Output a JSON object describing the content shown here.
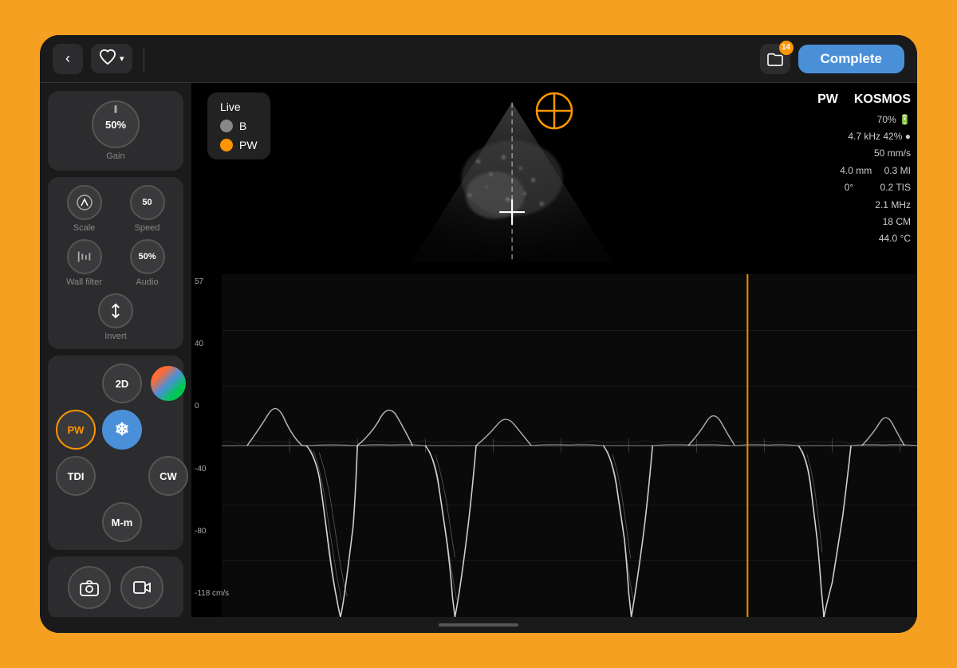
{
  "header": {
    "back_label": "‹",
    "heart_icon": "♥",
    "chevron": "▾",
    "folder_icon": "🗂",
    "badge_count": "14",
    "complete_label": "Complete"
  },
  "gain": {
    "value": "50%",
    "label": "Gain"
  },
  "controls": {
    "scale_label": "Scale",
    "speed_label": "Speed",
    "speed_value": "50",
    "wall_filter_label": "Wall filter",
    "audio_label": "Audio",
    "audio_value": "50%",
    "invert_label": "Invert"
  },
  "modes": {
    "two_d": "2D",
    "pw": "PW",
    "tdi": "TDI",
    "cw": "CW",
    "mm": "M-m"
  },
  "live_panel": {
    "label": "Live",
    "b_label": "B",
    "pw_label": "PW"
  },
  "info_panel": {
    "mode": "PW",
    "device": "KOSMOS",
    "battery_pct": "70%",
    "freq": "4.7",
    "freq_unit": "kHz",
    "thermal_pct": "42%",
    "speed": "50",
    "speed_unit": "mm/s",
    "depth": "4.0",
    "depth_unit": "mm",
    "mi_value": "0.3",
    "mi_label": "MI",
    "angle": "0°",
    "tis_value": "0.2",
    "tis_label": "TIS",
    "freq2": "2.1",
    "freq2_unit": "MHz",
    "cm_value": "18",
    "cm_unit": "CM",
    "temp": "44.0",
    "temp_unit": "°C"
  },
  "y_axis": {
    "labels": [
      "57",
      "40",
      "0",
      "-40",
      "-80",
      "-118 cm/s"
    ]
  },
  "actions": {
    "camera_icon": "📷",
    "record_icon": "⊡"
  }
}
